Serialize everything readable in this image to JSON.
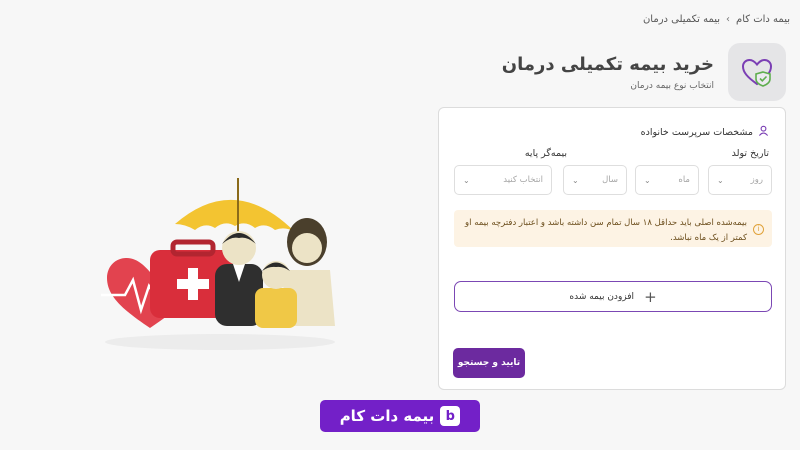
{
  "breadcrumb": {
    "items": [
      "بیمه دات کام",
      "بیمه تکمیلی درمان"
    ],
    "separator": "›"
  },
  "header": {
    "title": "خرید بیمه تکمیلی درمان",
    "subtitle": "انتخاب نوع بیمه درمان",
    "icon": "heart-shield-icon"
  },
  "form": {
    "section_title": "مشخصات سرپرست خانواده",
    "section_icon": "user-icon",
    "birth_date_label": "تاریخ تولد",
    "base_insurer_label": "بیمه‌گر پایه",
    "day_placeholder": "روز",
    "month_placeholder": "ماه",
    "year_placeholder": "سال",
    "insurer_placeholder": "انتخاب کنید",
    "notice": "بیمه‌شده اصلی باید حداقل ۱۸ سال تمام سن داشته باشد و اعتبار دفترچه بیمه او کمتر از یک ماه نباشد.",
    "add_insured_label": "افزودن بیمه شده",
    "submit_label": "تایید و جستجو"
  },
  "logo": {
    "text": "بیمه دات کام",
    "glyph": "b"
  },
  "colors": {
    "brand": "#7320c8",
    "button": "#6c2a9f",
    "notice_bg": "#fdf3e4",
    "accent_green": "#5fae4f"
  }
}
